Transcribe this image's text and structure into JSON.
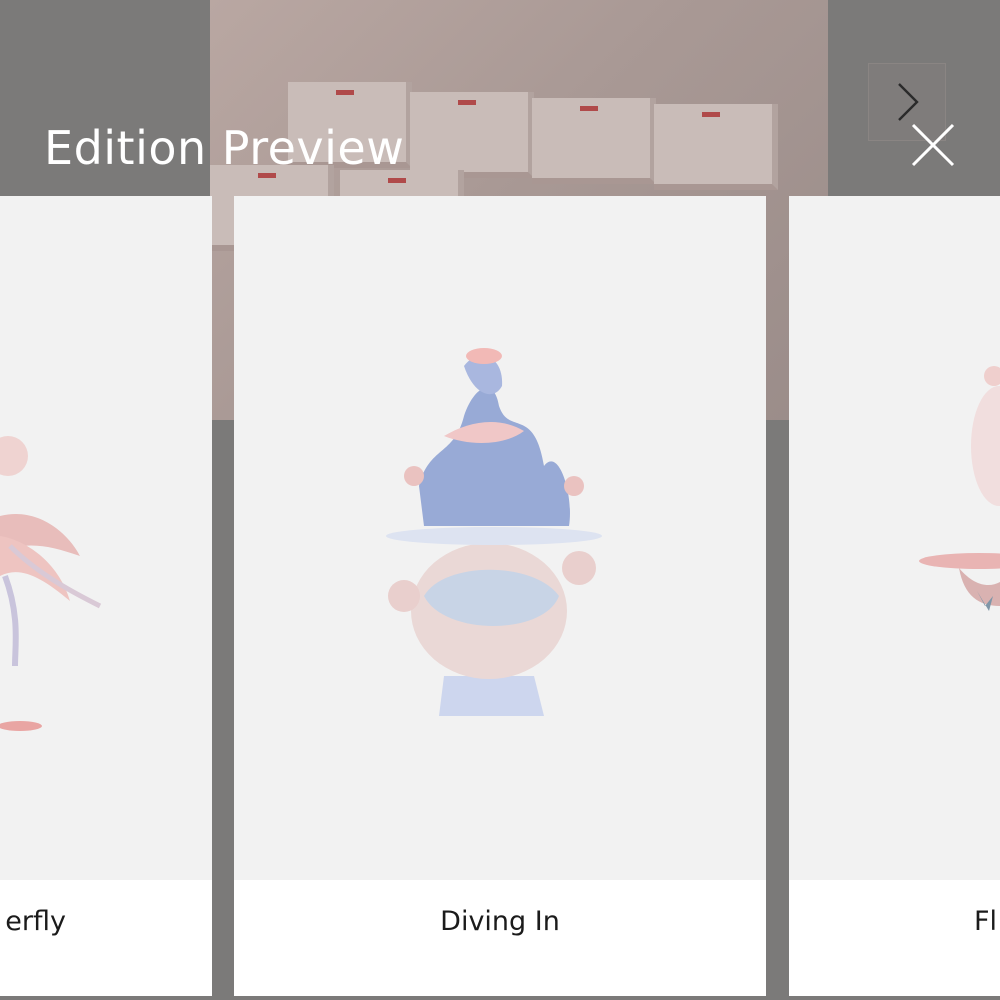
{
  "modal": {
    "title": "Edition Preview",
    "close_icon": "close-icon"
  },
  "background": {
    "next_icon": "chevron-right-icon"
  },
  "cards": [
    {
      "label": "erfly",
      "icon": "figure-image"
    },
    {
      "label": "Diving In",
      "icon": "figure-image"
    },
    {
      "label": "Fl",
      "icon": "figure-image"
    }
  ]
}
